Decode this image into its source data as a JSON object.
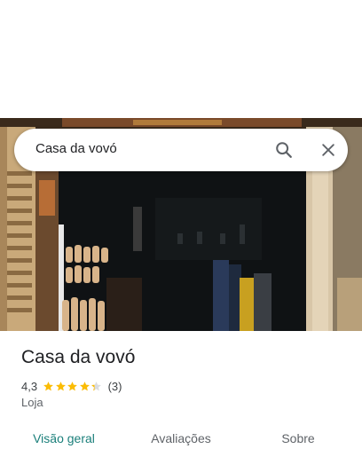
{
  "search": {
    "query": "Casa da vovó",
    "search_icon": "search-icon",
    "close_icon": "close-icon"
  },
  "place": {
    "name": "Casa da vovó",
    "rating": "4,3",
    "stars": 4.3,
    "review_count": "(3)",
    "category": "Loja"
  },
  "tabs": [
    {
      "label": "Visão geral",
      "active": true
    },
    {
      "label": "Avaliações",
      "active": false
    },
    {
      "label": "Sobre",
      "active": false
    }
  ],
  "colors": {
    "accent": "#1a7f7a",
    "star": "#fbbc04",
    "star_empty": "#dadce0"
  }
}
